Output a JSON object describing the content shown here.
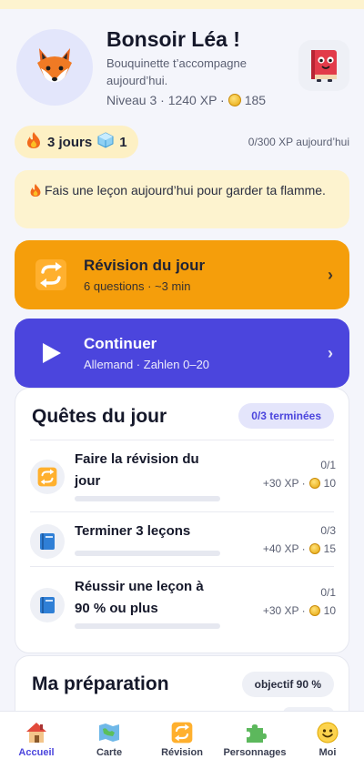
{
  "header": {
    "greeting": "Bonsoir Léa !",
    "subtitle": "Bouquinette t’accompagne aujourd’hui.",
    "level_xp": "Niveau 3 · 1240 XP ·",
    "coins": "185"
  },
  "streak": {
    "days_label": "3 jours",
    "freezes": "1",
    "xp_today": "0/300 XP aujourd’hui"
  },
  "alert": {
    "text": "Fais une leçon aujourd’hui pour garder ta flamme."
  },
  "actions": {
    "review": {
      "title": "Révision du jour",
      "subtitle": "6 questions · ~3 min"
    },
    "continue": {
      "title": "Continuer",
      "subtitle": "Allemand · Zahlen 0–20"
    }
  },
  "quests": {
    "title": "Quêtes du jour",
    "badge": "0/3 terminées",
    "items": [
      {
        "title": "Faire la révision du jour",
        "progress": "0/1",
        "reward_xp": "+30 XP ·",
        "reward_coins": "10",
        "fraction": 0,
        "icon": "review-icon"
      },
      {
        "title": "Terminer 3 leçons",
        "progress": "0/3",
        "reward_xp": "+40 XP ·",
        "reward_coins": "15",
        "fraction": 0,
        "icon": "book-icon"
      },
      {
        "title": "Réussir une leçon à 90 % ou plus",
        "progress": "0/1",
        "reward_xp": "+30 XP ·",
        "reward_coins": "10",
        "fraction": 0,
        "icon": "book-icon"
      }
    ]
  },
  "prep": {
    "title": "Ma préparation",
    "badge": "objectif 90 %"
  },
  "nav": {
    "items": [
      {
        "label": "Accueil",
        "icon": "home-icon",
        "active": true
      },
      {
        "label": "Carte",
        "icon": "map-icon",
        "active": false
      },
      {
        "label": "Révision",
        "icon": "review-icon",
        "active": false
      },
      {
        "label": "Personnages",
        "icon": "puzzle-icon",
        "active": false
      },
      {
        "label": "Moi",
        "icon": "smiley-icon",
        "active": false
      }
    ]
  },
  "colors": {
    "accent": "#4b45dd",
    "review": "#f59e0b",
    "streak_bg": "#fdf0c4",
    "alert_bg": "#fdf3cf"
  }
}
